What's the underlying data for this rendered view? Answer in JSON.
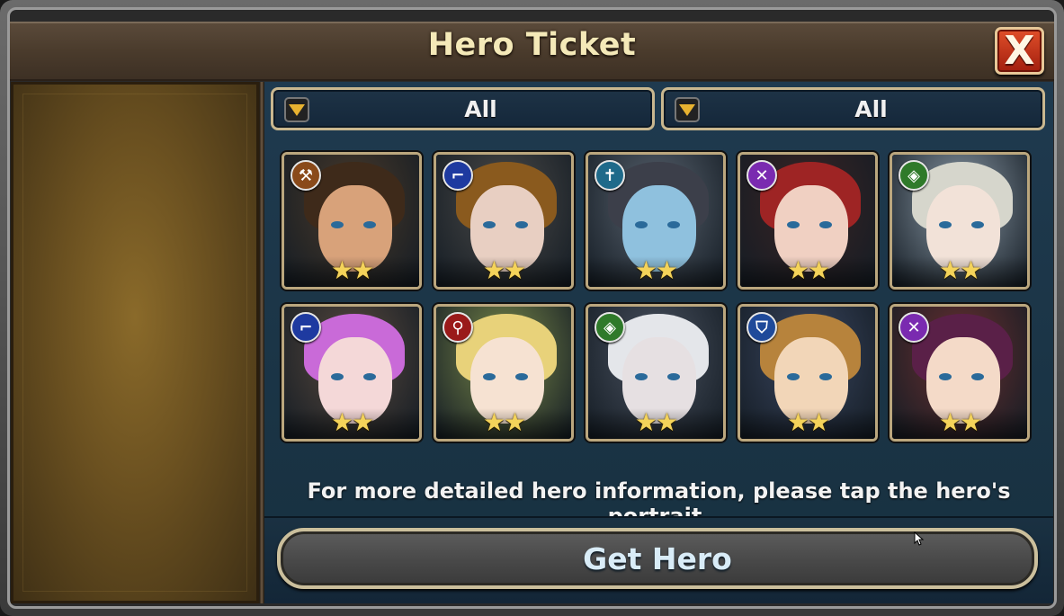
{
  "window": {
    "title": "Hero Ticket",
    "close_label": "X"
  },
  "filters": [
    {
      "label": "All"
    },
    {
      "label": "All"
    }
  ],
  "heroes": [
    {
      "class_icon": "axe-icon",
      "class_color": "#8a4a1a",
      "stars": 2,
      "hair": "#3e2a1a",
      "skin": "#d8a27a",
      "bg": "#4a3a2a"
    },
    {
      "class_icon": "gun-icon",
      "class_color": "#1e3aa0",
      "stars": 2,
      "hair": "#8a5a1e",
      "skin": "#e8cfc2",
      "bg": "#4b4a48"
    },
    {
      "class_icon": "cross-icon",
      "class_color": "#1f6a8a",
      "stars": 2,
      "hair": "#3c3f4a",
      "skin": "#8fc1de",
      "bg": "#5a6470"
    },
    {
      "class_icon": "crossed-swords-icon",
      "class_color": "#7a2ab0",
      "stars": 2,
      "hair": "#9e2424",
      "skin": "#f0d0c2",
      "bg": "#3a2424"
    },
    {
      "class_icon": "bow-icon",
      "class_color": "#2f7a2a",
      "stars": 2,
      "hair": "#d6d6cc",
      "skin": "#f2e2d8",
      "bg": "#8a99a6"
    },
    {
      "class_icon": "gun-icon",
      "class_color": "#1e3aa0",
      "stars": 2,
      "hair": "#c96ad8",
      "skin": "#f4d8d8",
      "bg": "#5a4a3e"
    },
    {
      "class_icon": "staff-icon",
      "class_color": "#9a1a1a",
      "stars": 2,
      "hair": "#e8d27a",
      "skin": "#f6e2d2",
      "bg": "#7a8a4a"
    },
    {
      "class_icon": "bow-icon",
      "class_color": "#2f7a2a",
      "stars": 2,
      "hair": "#e4e6ea",
      "skin": "#e6e0e2",
      "bg": "#4a5260"
    },
    {
      "class_icon": "shield-icon",
      "class_color": "#1f4a9a",
      "stars": 2,
      "hair": "#b7833c",
      "skin": "#f2d6b8",
      "bg": "#3a4660"
    },
    {
      "class_icon": "crossed-swords-icon",
      "class_color": "#7a2ab0",
      "stars": 2,
      "hair": "#5a2048",
      "skin": "#f4dac8",
      "bg": "#6a3030"
    }
  ],
  "info_text": "For more detailed hero information, please tap the hero's portrait.",
  "get_hero_label": "Get Hero"
}
